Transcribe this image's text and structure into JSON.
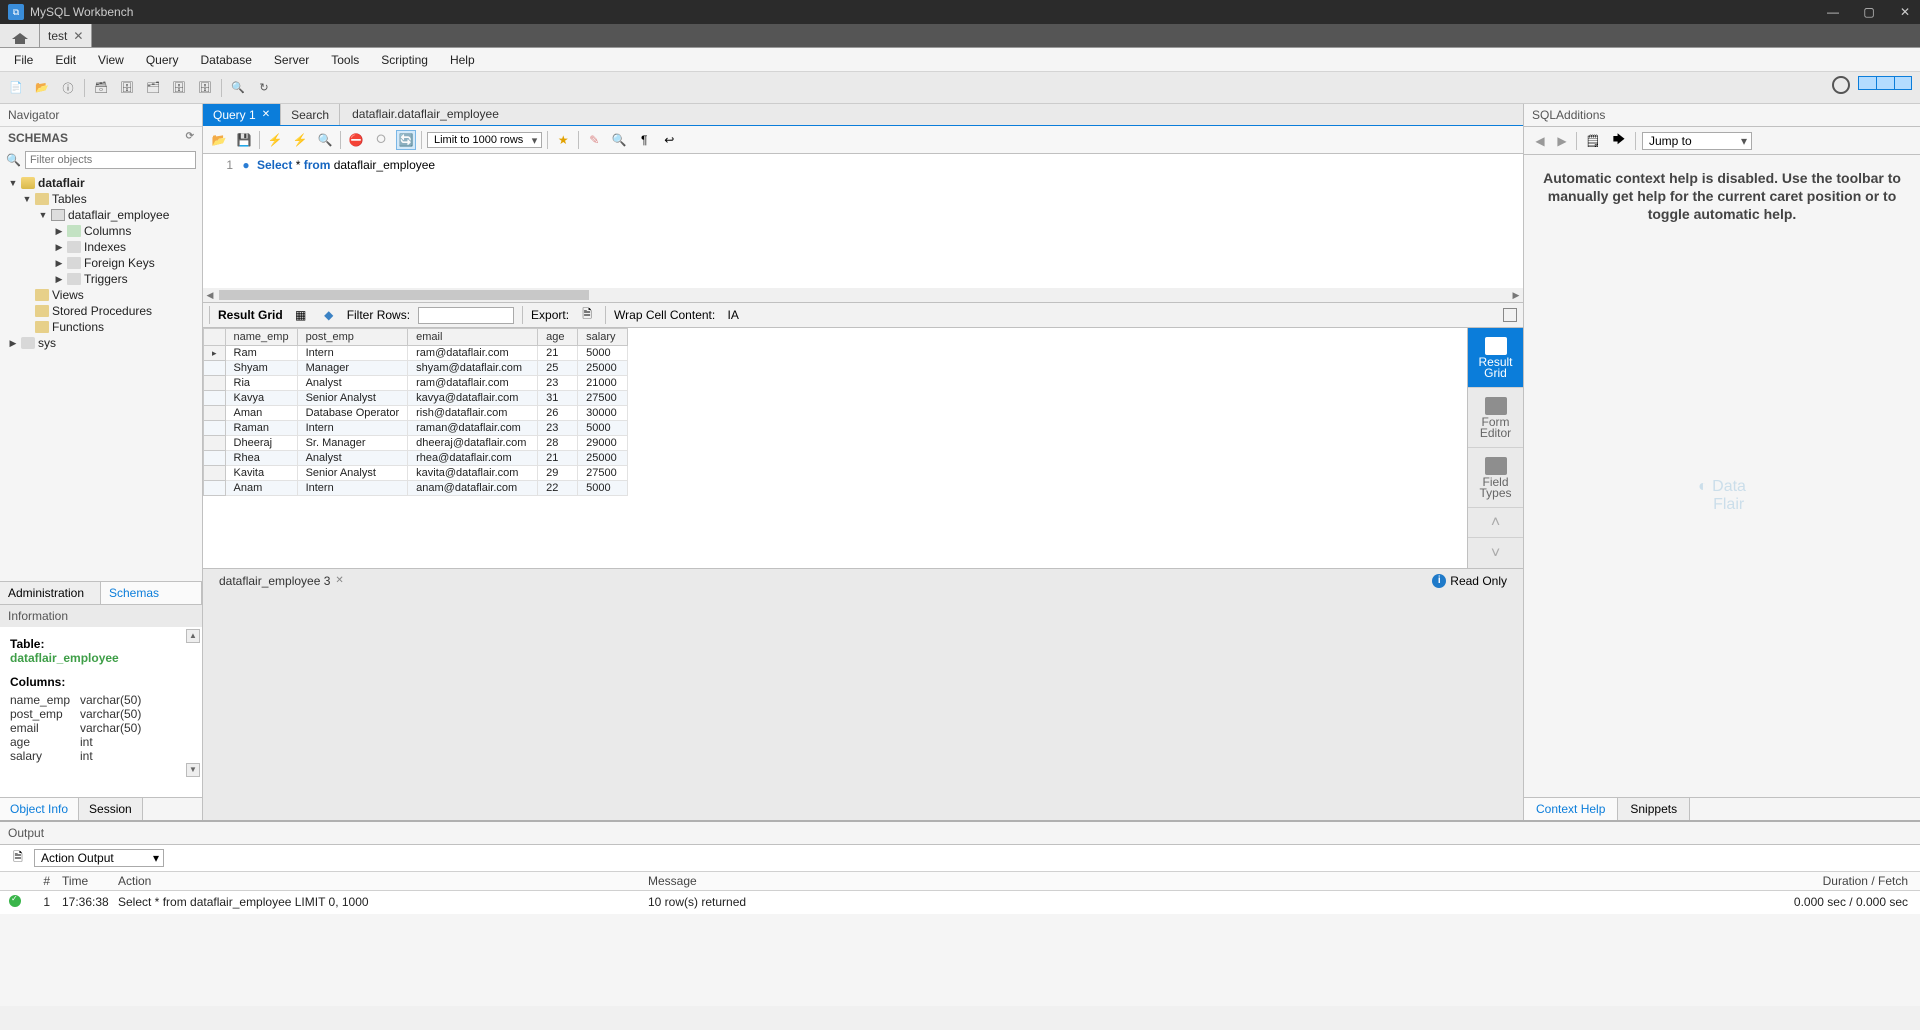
{
  "app_title": "MySQL Workbench",
  "connection_tab": "test",
  "menu": [
    "File",
    "Edit",
    "View",
    "Query",
    "Database",
    "Server",
    "Tools",
    "Scripting",
    "Help"
  ],
  "navigator": {
    "title": "Navigator",
    "schemas_label": "SCHEMAS",
    "filter_placeholder": "Filter objects",
    "tree": {
      "db": "dataflair",
      "tables": "Tables",
      "table": "dataflair_employee",
      "columns": "Columns",
      "indexes": "Indexes",
      "fkeys": "Foreign Keys",
      "triggers": "Triggers",
      "views": "Views",
      "sprocs": "Stored Procedures",
      "functions": "Functions",
      "sys": "sys"
    },
    "tabs": {
      "admin": "Administration",
      "schemas": "Schemas"
    }
  },
  "info": {
    "title": "Information",
    "tbl_label": "Table:",
    "tbl_name": "dataflair_employee",
    "cols_label": "Columns:",
    "cols": [
      {
        "n": "name_emp",
        "t": "varchar(50)"
      },
      {
        "n": "post_emp",
        "t": "varchar(50)"
      },
      {
        "n": "email",
        "t": "varchar(50)"
      },
      {
        "n": "age",
        "t": "int"
      },
      {
        "n": "salary",
        "t": "int"
      }
    ],
    "tabs": {
      "obj": "Object Info",
      "sess": "Session"
    }
  },
  "query": {
    "tab": "Query 1",
    "search_tab": "Search",
    "breadcrumb": "dataflair.dataflair_employee",
    "limit": "Limit to 1000 rows",
    "code_kw1": "Select",
    "code_star": " * ",
    "code_kw2": "from",
    "code_rest": " dataflair_employee",
    "line_no": "1"
  },
  "result": {
    "grid_label": "Result Grid",
    "filter_label": "Filter Rows:",
    "export_label": "Export:",
    "wrap_label": "Wrap Cell Content:",
    "headers": [
      "name_emp",
      "post_emp",
      "email",
      "age",
      "salary"
    ],
    "rows": [
      [
        "Ram",
        "Intern",
        "ram@dataflair.com",
        "21",
        "5000"
      ],
      [
        "Shyam",
        "Manager",
        "shyam@dataflair.com",
        "25",
        "25000"
      ],
      [
        "Ria",
        "Analyst",
        "ram@dataflair.com",
        "23",
        "21000"
      ],
      [
        "Kavya",
        "Senior Analyst",
        "kavya@dataflair.com",
        "31",
        "27500"
      ],
      [
        "Aman",
        "Database Operator",
        "rish@dataflair.com",
        "26",
        "30000"
      ],
      [
        "Raman",
        "Intern",
        "raman@dataflair.com",
        "23",
        "5000"
      ],
      [
        "Dheeraj",
        "Sr. Manager",
        "dheeraj@dataflair.com",
        "28",
        "29000"
      ],
      [
        "Rhea",
        "Analyst",
        "rhea@dataflair.com",
        "21",
        "25000"
      ],
      [
        "Kavita",
        "Senior Analyst",
        "kavita@dataflair.com",
        "29",
        "27500"
      ],
      [
        "Anam",
        "Intern",
        "anam@dataflair.com",
        "22",
        "5000"
      ]
    ],
    "side": {
      "grid": "Result\nGrid",
      "form": "Form\nEditor",
      "types": "Field\nTypes"
    },
    "tab_label": "dataflair_employee 3",
    "readonly": "Read Only"
  },
  "sql_add": {
    "title": "SQLAdditions",
    "jump": "Jump to",
    "help": "Automatic context help is disabled. Use the toolbar to manually get help for the current caret position or to toggle automatic help.",
    "tabs": {
      "ctx": "Context Help",
      "snip": "Snippets"
    }
  },
  "output": {
    "title": "Output",
    "selector": "Action Output",
    "headers": {
      "n": "#",
      "t": "Time",
      "a": "Action",
      "m": "Message",
      "d": "Duration / Fetch"
    },
    "row": {
      "n": "1",
      "t": "17:36:38",
      "a": "Select * from dataflair_employee LIMIT 0, 1000",
      "m": "10 row(s) returned",
      "d": "0.000 sec / 0.000 sec"
    }
  }
}
